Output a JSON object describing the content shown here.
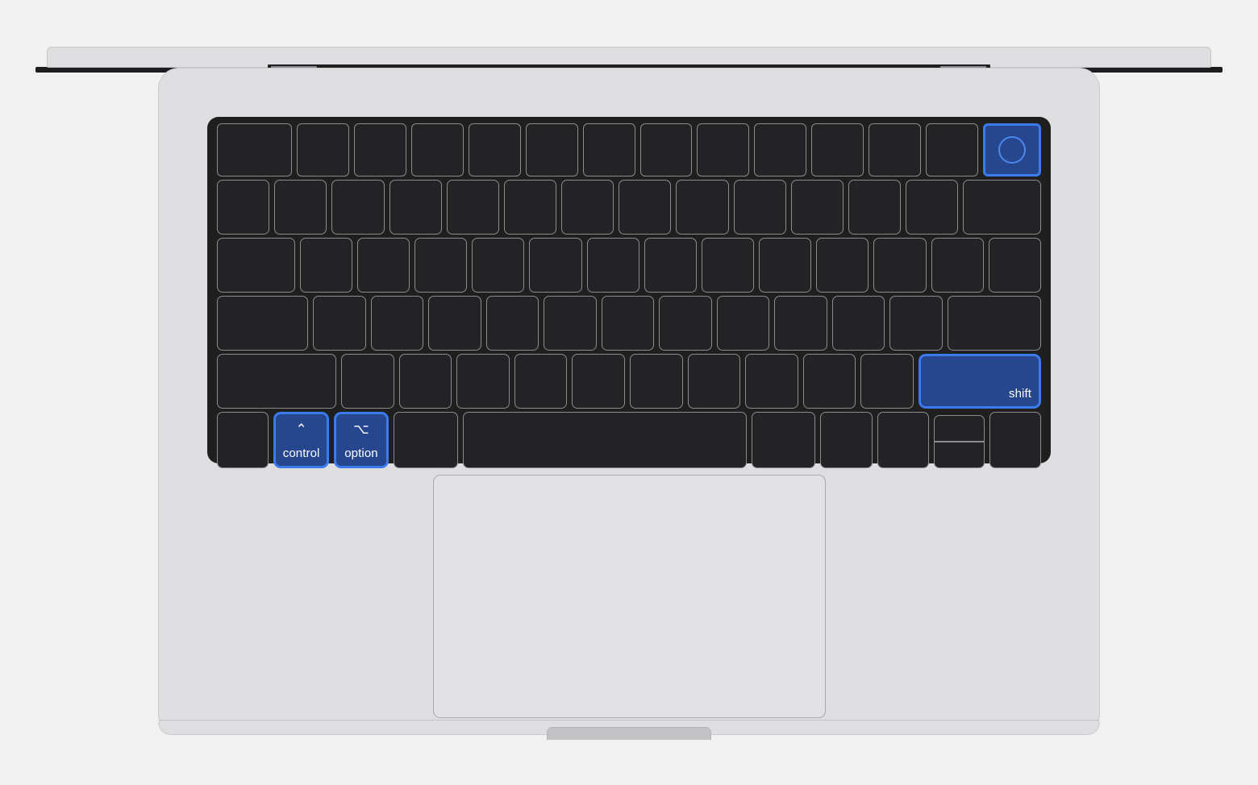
{
  "scene": {
    "title": "MacBook Pro top-down keyboard illustration with highlighted keys",
    "background_color": "#f1f1f1",
    "body_color": "#dedee0",
    "keyboard_color": "#201f20",
    "key_color": "#232224",
    "key_border_color": "#8b8b8e",
    "highlight_fill": "#26478d",
    "highlight_border": "#3a7bed",
    "trackpad_color": "#e2e2e4"
  },
  "parts": {
    "lid": "lid",
    "hinge": "hinge",
    "hinge_pad_left": "hinge-pad-left",
    "hinge_pad_right": "hinge-pad-right",
    "base": "base",
    "latch": "latch",
    "trackpad": "trackpad"
  },
  "keyboard": {
    "highlighted_keys": [
      "touch-id",
      "shift-right",
      "control",
      "option"
    ],
    "rows": [
      {
        "id": "function-row",
        "keys": [
          {
            "name": "esc",
            "label": "",
            "w": 1.45
          },
          {
            "name": "f1",
            "label": "",
            "w": 1
          },
          {
            "name": "f2",
            "label": "",
            "w": 1
          },
          {
            "name": "f3",
            "label": "",
            "w": 1
          },
          {
            "name": "f4",
            "label": "",
            "w": 1
          },
          {
            "name": "f5",
            "label": "",
            "w": 1
          },
          {
            "name": "f6",
            "label": "",
            "w": 1
          },
          {
            "name": "f7",
            "label": "",
            "w": 1
          },
          {
            "name": "f8",
            "label": "",
            "w": 1
          },
          {
            "name": "f9",
            "label": "",
            "w": 1
          },
          {
            "name": "f10",
            "label": "",
            "w": 1
          },
          {
            "name": "f11",
            "label": "",
            "w": 1
          },
          {
            "name": "f12",
            "label": "",
            "w": 1
          },
          {
            "name": "touch-id",
            "label": "",
            "w": 1.05,
            "highlight": true,
            "icon": "touch-id-icon"
          }
        ]
      },
      {
        "id": "number-row",
        "keys": [
          {
            "name": "grave",
            "label": "",
            "w": 1
          },
          {
            "name": "digit-1",
            "label": "",
            "w": 1
          },
          {
            "name": "digit-2",
            "label": "",
            "w": 1
          },
          {
            "name": "digit-3",
            "label": "",
            "w": 1
          },
          {
            "name": "digit-4",
            "label": "",
            "w": 1
          },
          {
            "name": "digit-5",
            "label": "",
            "w": 1
          },
          {
            "name": "digit-6",
            "label": "",
            "w": 1
          },
          {
            "name": "digit-7",
            "label": "",
            "w": 1
          },
          {
            "name": "digit-8",
            "label": "",
            "w": 1
          },
          {
            "name": "digit-9",
            "label": "",
            "w": 1
          },
          {
            "name": "digit-0",
            "label": "",
            "w": 1
          },
          {
            "name": "minus",
            "label": "",
            "w": 1
          },
          {
            "name": "equal",
            "label": "",
            "w": 1
          },
          {
            "name": "delete",
            "label": "",
            "w": 1.5
          }
        ]
      },
      {
        "id": "tab-row",
        "keys": [
          {
            "name": "tab",
            "label": "",
            "w": 1.5
          },
          {
            "name": "key-q",
            "label": "",
            "w": 1
          },
          {
            "name": "key-w",
            "label": "",
            "w": 1
          },
          {
            "name": "key-e",
            "label": "",
            "w": 1
          },
          {
            "name": "key-r",
            "label": "",
            "w": 1
          },
          {
            "name": "key-t",
            "label": "",
            "w": 1
          },
          {
            "name": "key-y",
            "label": "",
            "w": 1
          },
          {
            "name": "key-u",
            "label": "",
            "w": 1
          },
          {
            "name": "key-i",
            "label": "",
            "w": 1
          },
          {
            "name": "key-o",
            "label": "",
            "w": 1
          },
          {
            "name": "key-p",
            "label": "",
            "w": 1
          },
          {
            "name": "bracket-left",
            "label": "",
            "w": 1
          },
          {
            "name": "bracket-right",
            "label": "",
            "w": 1
          },
          {
            "name": "backslash",
            "label": "",
            "w": 1
          }
        ]
      },
      {
        "id": "home-row",
        "keys": [
          {
            "name": "caps-lock",
            "label": "",
            "w": 1.75
          },
          {
            "name": "key-a",
            "label": "",
            "w": 1
          },
          {
            "name": "key-s",
            "label": "",
            "w": 1
          },
          {
            "name": "key-d",
            "label": "",
            "w": 1
          },
          {
            "name": "key-f",
            "label": "",
            "w": 1
          },
          {
            "name": "key-g",
            "label": "",
            "w": 1
          },
          {
            "name": "key-h",
            "label": "",
            "w": 1
          },
          {
            "name": "key-j",
            "label": "",
            "w": 1
          },
          {
            "name": "key-k",
            "label": "",
            "w": 1
          },
          {
            "name": "key-l",
            "label": "",
            "w": 1
          },
          {
            "name": "semicolon",
            "label": "",
            "w": 1
          },
          {
            "name": "quote",
            "label": "",
            "w": 1
          },
          {
            "name": "return",
            "label": "",
            "w": 1.8
          }
        ]
      },
      {
        "id": "shift-row",
        "keys": [
          {
            "name": "shift-left",
            "label": "",
            "w": 2.3
          },
          {
            "name": "key-z",
            "label": "",
            "w": 1
          },
          {
            "name": "key-x",
            "label": "",
            "w": 1
          },
          {
            "name": "key-c",
            "label": "",
            "w": 1
          },
          {
            "name": "key-v",
            "label": "",
            "w": 1
          },
          {
            "name": "key-b",
            "label": "",
            "w": 1
          },
          {
            "name": "key-n",
            "label": "",
            "w": 1
          },
          {
            "name": "key-m",
            "label": "",
            "w": 1
          },
          {
            "name": "comma",
            "label": "",
            "w": 1
          },
          {
            "name": "period",
            "label": "",
            "w": 1
          },
          {
            "name": "slash",
            "label": "",
            "w": 1
          },
          {
            "name": "shift-right",
            "label": "shift",
            "w": 2.3,
            "highlight": true
          }
        ]
      },
      {
        "id": "bottom-row",
        "keys": [
          {
            "name": "fn",
            "label": "",
            "w": 1
          },
          {
            "name": "control",
            "label": "control",
            "symbol": "⌃",
            "w": 1,
            "highlight": true
          },
          {
            "name": "option-left",
            "label": "option",
            "symbol": "⌥",
            "w": 1,
            "highlight": true
          },
          {
            "name": "command-left",
            "label": "",
            "w": 1.25
          },
          {
            "name": "space",
            "label": "",
            "w": 5.6
          },
          {
            "name": "command-right",
            "label": "",
            "w": 1.25
          },
          {
            "name": "option-right",
            "label": "",
            "w": 1
          },
          {
            "name": "arrow-left",
            "label": "",
            "w": 1
          },
          {
            "name": "arrow-up-down",
            "label": "",
            "w": 1
          },
          {
            "name": "arrow-right",
            "label": "",
            "w": 1
          }
        ]
      }
    ]
  }
}
